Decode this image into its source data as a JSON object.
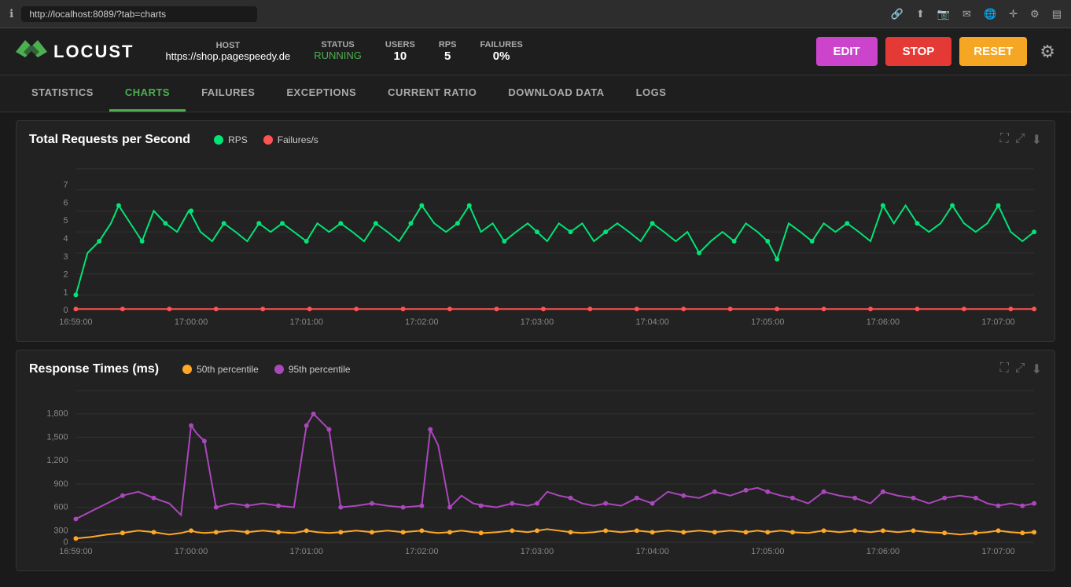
{
  "browser": {
    "url": "http://localhost:8089/?tab=charts",
    "icons": [
      "link-icon",
      "share-icon",
      "camera-icon",
      "mail-icon",
      "globe-icon",
      "navigate-icon",
      "settings-icon",
      "sidebar-icon"
    ]
  },
  "header": {
    "logo_text": "LOCUST",
    "host_label": "HOST",
    "host_value": "https://shop.pagespeedy.de",
    "status_label": "STATUS",
    "status_value": "RUNNING",
    "users_label": "USERS",
    "users_value": "10",
    "rps_label": "RPS",
    "rps_value": "5",
    "failures_label": "FAILURES",
    "failures_value": "0%",
    "btn_edit": "EDIT",
    "btn_stop": "STOP",
    "btn_reset": "RESET"
  },
  "tabs": [
    {
      "id": "statistics",
      "label": "STATISTICS",
      "active": false
    },
    {
      "id": "charts",
      "label": "CHARTS",
      "active": true
    },
    {
      "id": "failures",
      "label": "FAILURES",
      "active": false
    },
    {
      "id": "exceptions",
      "label": "EXCEPTIONS",
      "active": false
    },
    {
      "id": "current-ratio",
      "label": "CURRENT RATIO",
      "active": false
    },
    {
      "id": "download-data",
      "label": "DOWNLOAD DATA",
      "active": false
    },
    {
      "id": "logs",
      "label": "LOGS",
      "active": false
    }
  ],
  "charts": {
    "rps_chart": {
      "title": "Total Requests per Second",
      "legend": [
        {
          "label": "RPS",
          "color": "#00e676"
        },
        {
          "label": "Failures/s",
          "color": "#ff5252"
        }
      ],
      "x_labels": [
        "16:59:00",
        "17:00:00",
        "17:01:00",
        "17:02:00",
        "17:03:00",
        "17:04:00",
        "17:05:00",
        "17:06:00",
        "17:07:00"
      ],
      "y_labels": [
        "0",
        "1",
        "2",
        "3",
        "4",
        "5",
        "6",
        "7"
      ]
    },
    "response_chart": {
      "title": "Response Times (ms)",
      "legend": [
        {
          "label": "50th percentile",
          "color": "#ffa726"
        },
        {
          "label": "95th percentile",
          "color": "#ab47bc"
        }
      ],
      "x_labels": [
        "16:59:00",
        "17:00:00",
        "17:01:00",
        "17:02:00",
        "17:03:00",
        "17:04:00",
        "17:05:00",
        "17:06:00",
        "17:07:00"
      ],
      "y_labels": [
        "0",
        "300",
        "600",
        "900",
        "1,200",
        "1,500",
        "1,800"
      ]
    }
  }
}
